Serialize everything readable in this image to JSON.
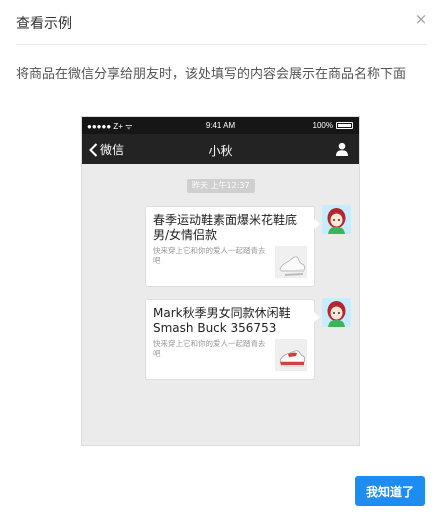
{
  "dialog": {
    "title": "查看示例",
    "close_symbol": "×",
    "description": "将商品在微信分享给朋友时，该处填写的内容会展示在商品名称下面",
    "ok_label": "我知道了"
  },
  "phone": {
    "status_left": "●●●●● Z+ ᯤ",
    "status_time": "9:41 AM",
    "status_battery": "100%",
    "back_label": "微信",
    "chat_title": "小秋",
    "timestamp": "昨天 上午12:37",
    "messages": [
      {
        "title": "春季运动鞋素面爆米花鞋底男/女情侣款",
        "text": "快来穿上它和你的爱人一起踏青去吧",
        "thumb_icon": "white-sneaker-thumbnail"
      },
      {
        "title": "Mark秋季男女同款休闲鞋Smash Buck 356753",
        "text": "快来穿上它和你的爱人一起踏青去吧",
        "thumb_icon": "red-white-sneaker-thumbnail"
      }
    ]
  },
  "colors": {
    "primary_button": "#1e8cf0",
    "nav_bar": "#232323",
    "chat_bg": "#ebebeb"
  }
}
